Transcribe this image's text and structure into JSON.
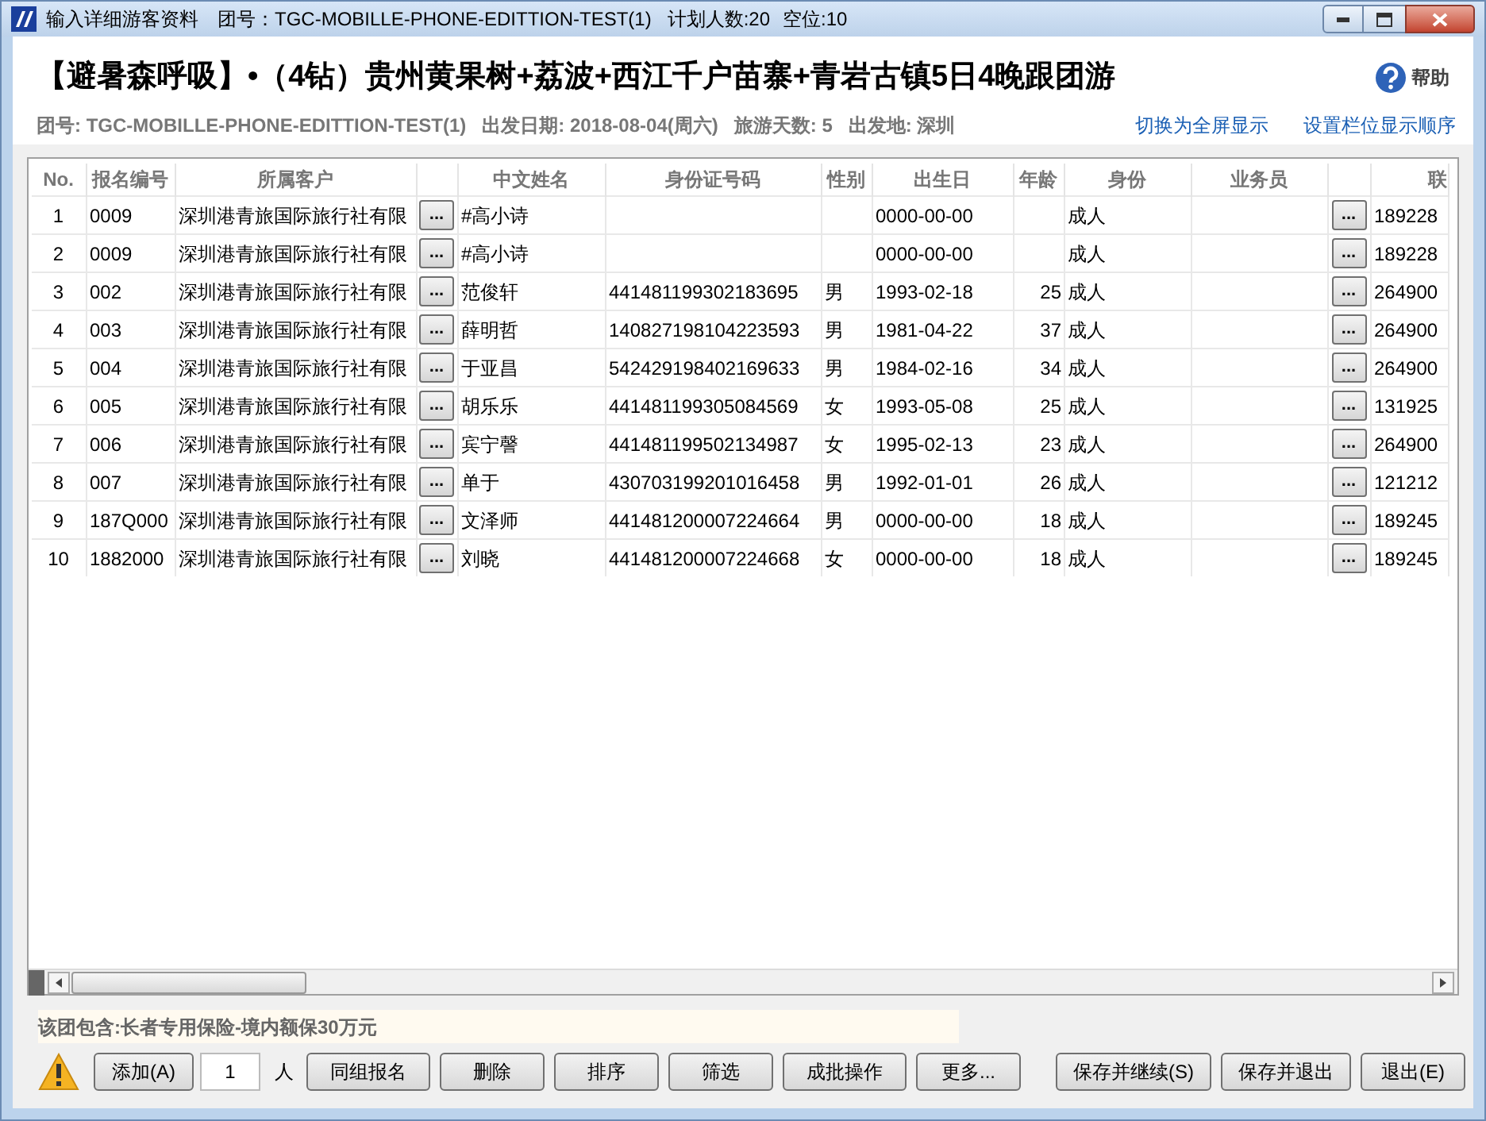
{
  "window": {
    "title": "输入详细游客资料",
    "group_no": "团号：TGC-MOBILLE-PHONE-EDITTION-TEST(1)",
    "planned": "计划人数:20",
    "vacancy": "空位:10"
  },
  "header": {
    "title": "【避暑森呼吸】•（4钻）贵州黄果树+荔波+西江千户苗寨+青岩古镇5日4晚跟团游",
    "help": "帮助",
    "info": [
      {
        "label": "团号:",
        "value": "TGC-MOBILLE-PHONE-EDITTION-TEST(1)"
      },
      {
        "label": "出发日期:",
        "value": "2018-08-04(周六)"
      },
      {
        "label": "旅游天数:",
        "value": "5"
      },
      {
        "label": "出发地:",
        "value": "深圳"
      }
    ],
    "links": [
      "切换为全屏显示",
      "设置栏位显示顺序"
    ]
  },
  "table": {
    "columns": [
      "No.",
      "报名编号",
      "所属客户",
      "中文姓名",
      "身份证号码",
      "性别",
      "出生日",
      "年龄",
      "身份",
      "业务员",
      "联"
    ],
    "button_label": "...",
    "rows": [
      {
        "no": "1",
        "reg_no": "0009",
        "customer": "深圳港青旅国际旅行社有限",
        "name": "#高小诗",
        "birth": "0000-00-00",
        "identity": "成人",
        "phone": "189228"
      },
      {
        "no": "2",
        "reg_no": "0009",
        "customer": "深圳港青旅国际旅行社有限",
        "name": "#高小诗",
        "birth": "0000-00-00",
        "identity": "成人",
        "phone": "189228"
      },
      {
        "no": "3",
        "reg_no": "002",
        "customer": "深圳港青旅国际旅行社有限",
        "name": "范俊轩",
        "id": "441481199302183695",
        "gender": "男",
        "birth": "1993-02-18",
        "age": "25",
        "identity": "成人",
        "phone": "264900"
      },
      {
        "no": "4",
        "reg_no": "003",
        "customer": "深圳港青旅国际旅行社有限",
        "name": "薛明哲",
        "id": "140827198104223593",
        "gender": "男",
        "birth": "1981-04-22",
        "age": "37",
        "identity": "成人",
        "phone": "264900"
      },
      {
        "no": "5",
        "reg_no": "004",
        "customer": "深圳港青旅国际旅行社有限",
        "name": "于亚昌",
        "id": "542429198402169633",
        "gender": "男",
        "birth": "1984-02-16",
        "age": "34",
        "identity": "成人",
        "phone": "264900"
      },
      {
        "no": "6",
        "reg_no": "005",
        "customer": "深圳港青旅国际旅行社有限",
        "name": "胡乐乐",
        "id": "441481199305084569",
        "gender": "女",
        "birth": "1993-05-08",
        "age": "25",
        "identity": "成人",
        "phone": "131925"
      },
      {
        "no": "7",
        "reg_no": "006",
        "customer": "深圳港青旅国际旅行社有限",
        "name": "宾宁謦",
        "id": "441481199502134987",
        "gender": "女",
        "birth": "1995-02-13",
        "age": "23",
        "identity": "成人",
        "phone": "264900"
      },
      {
        "no": "8",
        "reg_no": "007",
        "customer": "深圳港青旅国际旅行社有限",
        "name": "单于",
        "id": "430703199201016458",
        "gender": "男",
        "birth": "1992-01-01",
        "age": "26",
        "identity": "成人",
        "phone": "121212"
      },
      {
        "no": "9",
        "reg_no": "187Q000",
        "customer": "深圳港青旅国际旅行社有限",
        "name": "文泽师",
        "id": "441481200007224664",
        "gender": "男",
        "birth": "0000-00-00",
        "age": "18",
        "identity": "成人",
        "phone": "189245"
      },
      {
        "no": "10",
        "reg_no": "1882000",
        "customer": "深圳港青旅国际旅行社有限",
        "name": "刘晓",
        "id": "441481200007224668",
        "gender": "女",
        "birth": "0000-00-00",
        "age": "18",
        "identity": "成人",
        "phone": "189245"
      }
    ]
  },
  "note": "该团包含:长者专用保险-境内额保30万元",
  "footer": {
    "add": "添加(A)",
    "count": "1",
    "unit": "人",
    "buttons": [
      "同组报名",
      "删除",
      "排序",
      "筛选",
      "成批操作",
      "更多..."
    ],
    "right_buttons": [
      "保存并继续(S)",
      "保存并退出",
      "退出(E)"
    ]
  }
}
